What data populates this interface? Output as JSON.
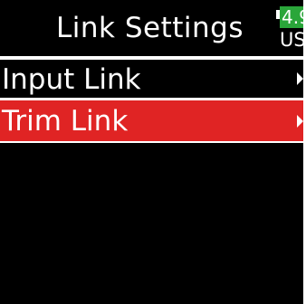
{
  "header": {
    "title": "Link Settings",
    "battery": {
      "level_text": "4.9",
      "source_text": "USB",
      "color": "#2aa63a"
    }
  },
  "menu": {
    "items": [
      {
        "label": "Input Link",
        "selected": false,
        "icon": "chevron-right-icon"
      },
      {
        "label": "Trim Link",
        "selected": true,
        "icon": "chevron-right-icon"
      }
    ],
    "selected_color": "#e02424"
  }
}
